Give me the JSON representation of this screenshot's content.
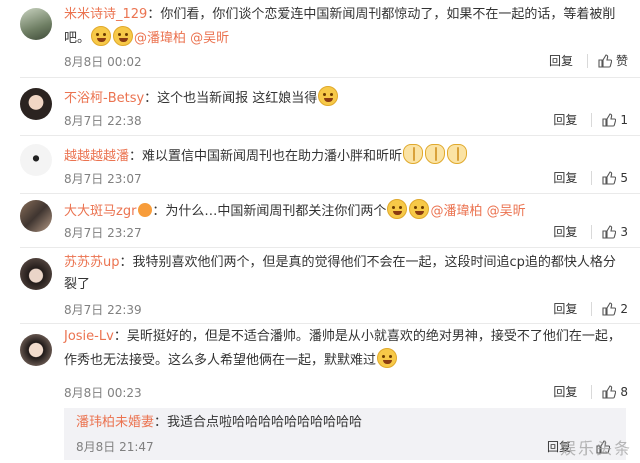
{
  "comments": [
    {
      "user": "米米诗诗_129",
      "text": "：你们看，你们谈个恋爱连中国新闻周刊都惊动了，如果不在一起的话，等着被削吧。",
      "mentions": [
        "@潘瑋柏",
        "@吴昕"
      ],
      "time": "8月8日 00:02",
      "reply": "回复",
      "likes": "赞"
    },
    {
      "user": "不浴柯-Betsy",
      "text": "：这个也当新闻报 这红娘当得",
      "time": "8月7日 22:38",
      "reply": "回复",
      "likes": "1"
    },
    {
      "user": "越越越越潘",
      "text": "：难以置信中国新闻周刊也在助力潘小胖和昕昕",
      "time": "8月7日 23:07",
      "reply": "回复",
      "likes": "5"
    },
    {
      "user": "大大斑马zgr",
      "text": "：为什么…中国新闻周刊都关注你们两个",
      "mentions": [
        "@潘瑋柏",
        "@吴昕"
      ],
      "time": "8月7日 23:27",
      "reply": "回复",
      "likes": "3"
    },
    {
      "user": "苏苏苏up",
      "text": "：我特别喜欢他们两个，但是真的觉得他们不会在一起，这段时间追cp追的都快人格分裂了",
      "time": "8月7日 22:39",
      "reply": "回复",
      "likes": "2"
    },
    {
      "user": "Josie-Lv",
      "text": "：吴昕挺好的，但是不适合潘帅。潘帅是从小就喜欢的绝对男神，接受不了他们在一起，作秀也无法接受。这么多人希望他俩在一起，默默难过",
      "time": "8月8日 00:23",
      "reply": "回复",
      "likes": "8"
    }
  ],
  "subreply": {
    "user": "潘玮柏未婚妻",
    "text": "：我适合点啦哈哈哈哈哈哈哈哈哈哈",
    "time": "8月8日 21:47",
    "reply": "回复"
  },
  "watermark": "娱乐头条",
  "colors": {
    "username": "#eb7350",
    "time": "#808080"
  }
}
